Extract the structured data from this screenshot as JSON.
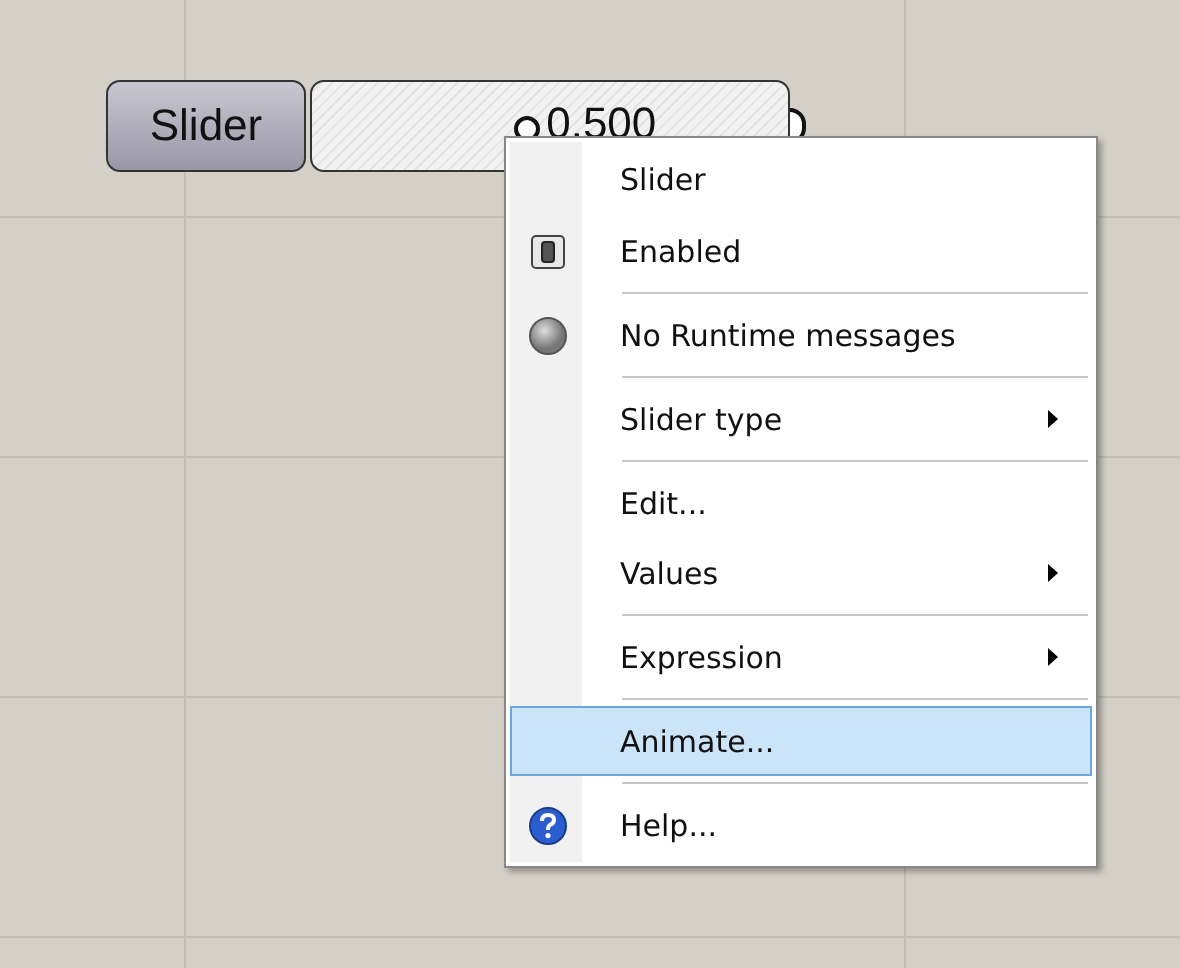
{
  "slider": {
    "label": "Slider",
    "value": "0.500",
    "level": 0.45
  },
  "context_menu": {
    "items": [
      {
        "kind": "title",
        "label": "Slider",
        "submenu": false,
        "selected": false
      },
      {
        "kind": "toggle",
        "label": "Enabled",
        "submenu": false,
        "selected": false
      },
      {
        "kind": "separator"
      },
      {
        "kind": "status",
        "label": "No Runtime messages",
        "submenu": false,
        "selected": false
      },
      {
        "kind": "separator"
      },
      {
        "kind": "plain",
        "label": "Slider type",
        "submenu": true,
        "selected": false
      },
      {
        "kind": "separator"
      },
      {
        "kind": "plain",
        "label": "Edit...",
        "submenu": false,
        "selected": false
      },
      {
        "kind": "plain",
        "label": "Values",
        "submenu": true,
        "selected": false
      },
      {
        "kind": "separator"
      },
      {
        "kind": "plain",
        "label": "Expression",
        "submenu": true,
        "selected": false
      },
      {
        "kind": "separator"
      },
      {
        "kind": "plain",
        "label": "Animate...",
        "submenu": false,
        "selected": true
      },
      {
        "kind": "separator"
      },
      {
        "kind": "help",
        "label": "Help...",
        "submenu": false,
        "selected": false
      }
    ]
  }
}
